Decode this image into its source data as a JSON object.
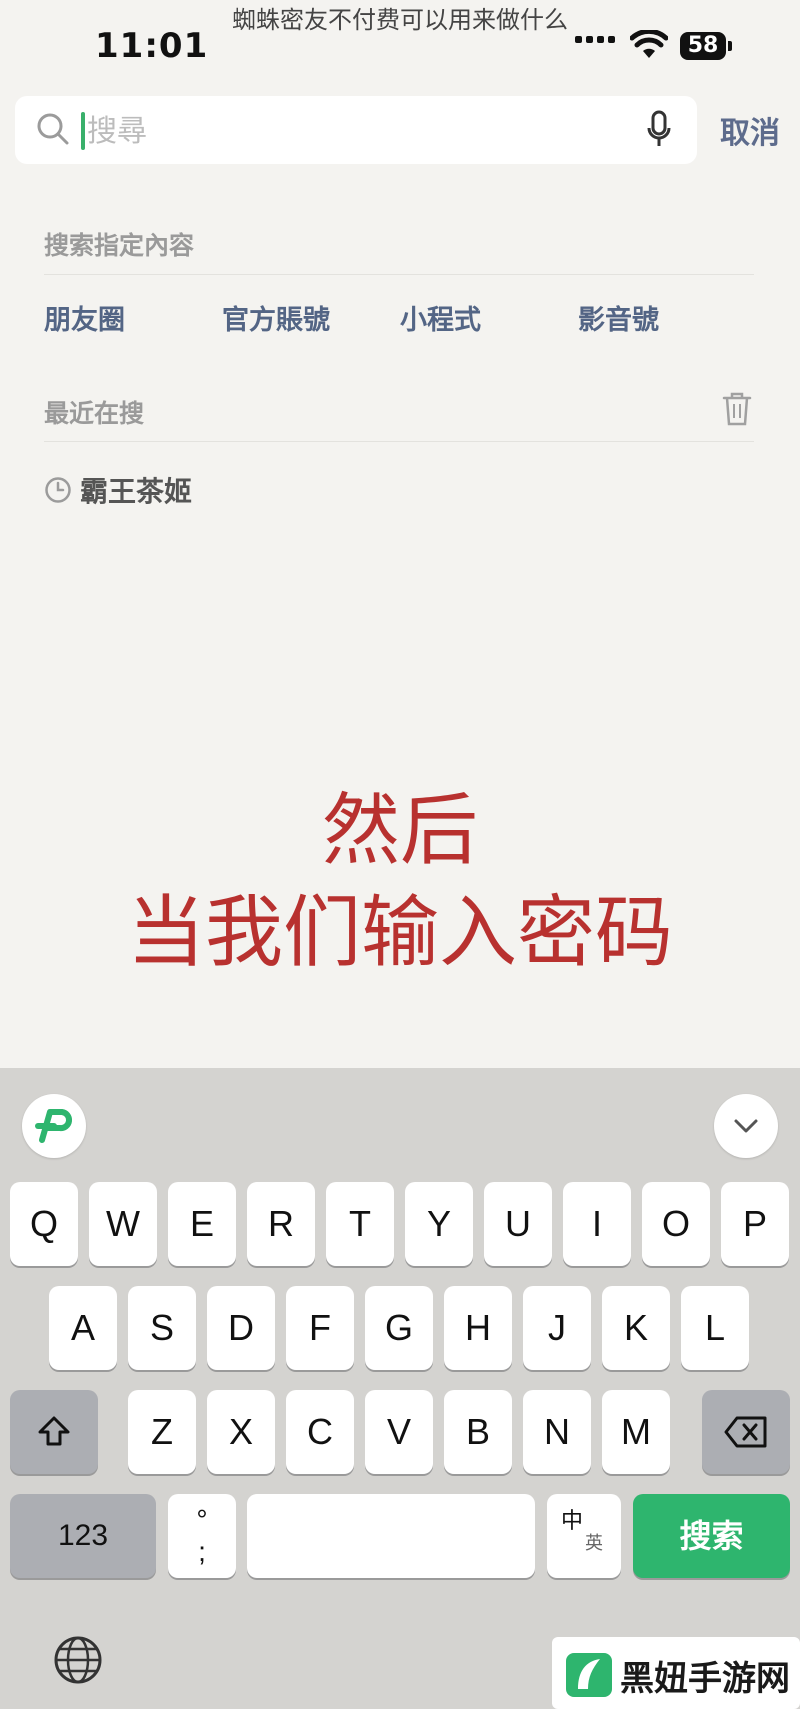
{
  "caption": "蜘蛛密友不付费可以用来做什么",
  "status_bar": {
    "time": "11:01",
    "battery": "58"
  },
  "search": {
    "placeholder": "搜尋",
    "cancel": "取消"
  },
  "specific": {
    "label": "搜索指定內容",
    "categories": [
      "朋友圈",
      "官方賬號",
      "小程式",
      "影音號"
    ]
  },
  "recent": {
    "label": "最近在搜",
    "items": [
      "霸王茶姬"
    ]
  },
  "overlay": {
    "line1": "然后",
    "line2": "当我们输入密码"
  },
  "keyboard": {
    "row1": [
      "Q",
      "W",
      "E",
      "R",
      "T",
      "Y",
      "U",
      "I",
      "O",
      "P"
    ],
    "row2": [
      "A",
      "S",
      "D",
      "F",
      "G",
      "H",
      "J",
      "K",
      "L"
    ],
    "row3": [
      "Z",
      "X",
      "C",
      "V",
      "B",
      "N",
      "M"
    ],
    "numbers_key": "123",
    "punct_key": "°\n;",
    "lang_key_top": "中",
    "lang_key_bottom": "英",
    "search_key": "搜索"
  },
  "watermark": {
    "text": "黑妞手游网"
  },
  "colors": {
    "accent": "#2eb56e",
    "overlay_red": "#b8312f",
    "link_blue": "#5d6b8c"
  }
}
